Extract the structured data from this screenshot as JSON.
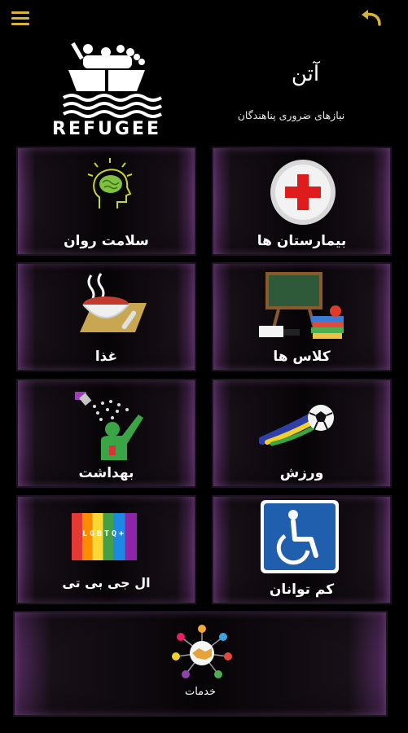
{
  "header": {
    "menu_icon": "hamburger-menu-icon",
    "back_icon": "undo-arrow-icon",
    "accent_color": "#d9b23a"
  },
  "logo": {
    "text": "REFUGEE",
    "icon": "refugee-boat-logo"
  },
  "app": {
    "title": "آتن",
    "subtitle": "نیازهای ضروری پناهندگان"
  },
  "tiles": [
    {
      "label": "سلامت روان",
      "icon": "mental-health-head-icon"
    },
    {
      "label": "بیمارستان ها",
      "icon": "red-cross-icon"
    },
    {
      "label": "غذا",
      "icon": "food-bowl-icon"
    },
    {
      "label": "کلاس ها",
      "icon": "classroom-blackboard-icon"
    },
    {
      "label": "بهداشت",
      "icon": "shower-hygiene-icon"
    },
    {
      "label": "ورزش",
      "icon": "soccer-ball-icon"
    },
    {
      "label": "ال جی بی تی",
      "icon": "lgbtq-flag-icon",
      "flag_text": "LGBTQ+"
    },
    {
      "label": "کم توانان",
      "icon": "wheelchair-icon"
    },
    {
      "label": "خدمات",
      "icon": "services-handshake-icon"
    }
  ]
}
